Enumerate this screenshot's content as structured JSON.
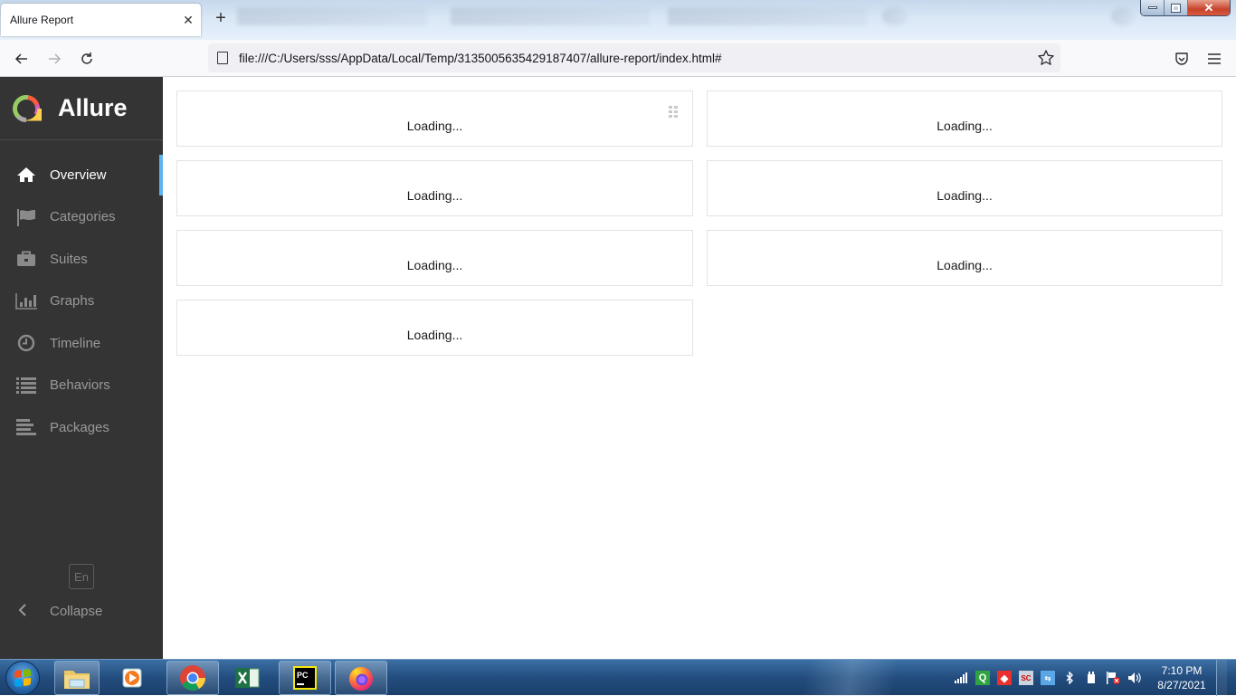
{
  "browser": {
    "active_tab": {
      "title": "Allure Report",
      "close_icon": "close-icon"
    },
    "new_tab_icon": "plus-icon",
    "background_tabs_count": 3,
    "window_controls": [
      "minimize",
      "restore",
      "close"
    ],
    "nav": {
      "back_icon": "arrow-left-icon",
      "forward_icon": "arrow-right-icon",
      "reload_icon": "reload-icon"
    },
    "url": "file:///C:/Users/sss/AppData/Local/Temp/3135005635429187407/allure-report/index.html#",
    "bookmark_icon": "star-icon",
    "pocket_icon": "pocket-icon",
    "menu_icon": "hamburger-icon"
  },
  "sidebar": {
    "brand": "Allure",
    "logo_colors": [
      "#97cc64",
      "#fd5a3e",
      "#d35ebe",
      "#ffd050",
      "#aaaaaa"
    ],
    "active_color": "#5fb5f1",
    "items": [
      {
        "label": "Overview",
        "icon": "home-icon",
        "active": true
      },
      {
        "label": "Categories",
        "icon": "flag-icon",
        "active": false
      },
      {
        "label": "Suites",
        "icon": "briefcase-icon",
        "active": false
      },
      {
        "label": "Graphs",
        "icon": "bar-chart-icon",
        "active": false
      },
      {
        "label": "Timeline",
        "icon": "clock-icon",
        "active": false
      },
      {
        "label": "Behaviors",
        "icon": "list-icon",
        "active": false
      },
      {
        "label": "Packages",
        "icon": "align-left-icon",
        "active": false
      }
    ],
    "language": "En",
    "collapse_label": "Collapse"
  },
  "widgets": [
    {
      "text": "Loading..."
    },
    {
      "text": "Loading..."
    },
    {
      "text": "Loading..."
    },
    {
      "text": "Loading..."
    },
    {
      "text": "Loading..."
    },
    {
      "text": "Loading..."
    },
    {
      "text": "Loading..."
    }
  ],
  "taskbar": {
    "apps": [
      "file-explorer",
      "media-player",
      "chrome",
      "excel",
      "pycharm",
      "firefox"
    ],
    "tray_icons": [
      "signal-icon",
      "q-icon",
      "red-app-icon",
      "sc-icon",
      "network-app-icon",
      "bluetooth-icon",
      "power-icon",
      "action-center-icon",
      "volume-icon"
    ],
    "time": "7:10 PM",
    "date": "8/27/2021"
  }
}
